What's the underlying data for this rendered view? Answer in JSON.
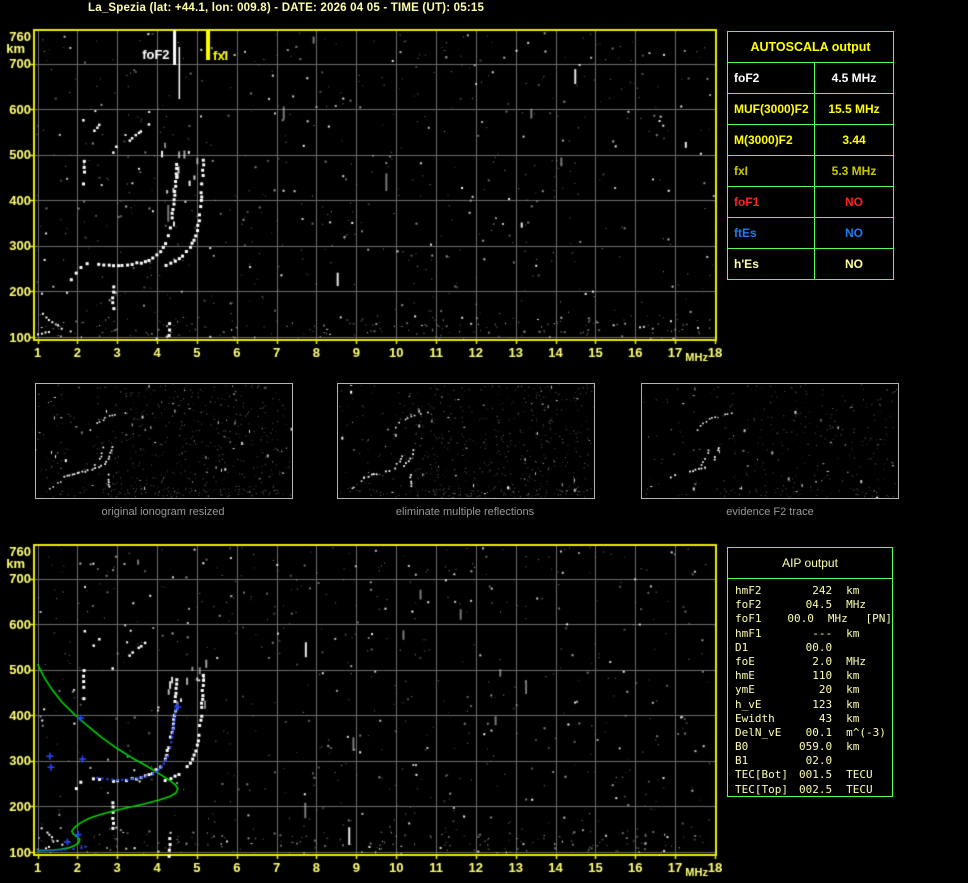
{
  "title": "La_Spezia (lat: +44.1, lon: 009.8) - DATE: 2026 04 05 - TIME (UT): 05:15",
  "colors": {
    "title_text": "#ffffa8",
    "axis_text": "#ffff78",
    "plot_border": "#ecec00",
    "grid": "#6a6a6a",
    "noise_dim": "#989898",
    "noise_bright": "#ffffff",
    "trace_white": "#ffffff",
    "table_border": "#55ff55",
    "autoscala_header": "#ffff00",
    "aip_text": "#ffffb0",
    "caption_text": "#989898",
    "profile_green": "#00d400",
    "restored_blue": "#2244ff",
    "marker_foF2": "#ffffff",
    "marker_fxI": "#ffff00"
  },
  "autoscala_table": {
    "header": "AUTOSCALA output",
    "rows": [
      {
        "label": "foF2",
        "value": "4.5 MHz",
        "color": "#ffffff"
      },
      {
        "label": "MUF(3000)F2",
        "value": "15.5 MHz",
        "color": "#ffff00"
      },
      {
        "label": "M(3000)F2",
        "value": "3.44",
        "color": "#ffff00"
      },
      {
        "label": "fxI",
        "value": "5.3 MHz",
        "color": "#c9c900"
      },
      {
        "label": "foF1",
        "value": "NO",
        "color": "#ff2020"
      },
      {
        "label": "ftEs",
        "value": "NO",
        "color": "#1a7cf0"
      },
      {
        "label": "h'Es",
        "value": "NO",
        "color": "#ffffa0"
      }
    ]
  },
  "aip_table": {
    "header": "AIP output",
    "rows": [
      {
        "label": "hmF2",
        "value": "242",
        "unit": "km",
        "extra": ""
      },
      {
        "label": "foF2",
        "value": "04.5",
        "unit": "MHz",
        "extra": ""
      },
      {
        "label": "foF1",
        "value": "00.0",
        "unit": "MHz",
        "extra": "[PN]"
      },
      {
        "label": "hmF1",
        "value": "---",
        "unit": "km",
        "extra": ""
      },
      {
        "label": "D1",
        "value": "00.0",
        "unit": "",
        "extra": ""
      },
      {
        "label": "foE",
        "value": "2.0",
        "unit": "MHz",
        "extra": ""
      },
      {
        "label": "hmE",
        "value": "110",
        "unit": "km",
        "extra": ""
      },
      {
        "label": "ymE",
        "value": "20",
        "unit": "km",
        "extra": ""
      },
      {
        "label": "h_vE",
        "value": "123",
        "unit": "km",
        "extra": ""
      },
      {
        "label": "Ewidth",
        "value": "43",
        "unit": "km",
        "extra": ""
      },
      {
        "label": "DelN_vE",
        "value": "00.1",
        "unit": "m^(-3)",
        "extra": ""
      },
      {
        "label": "B0",
        "value": "059.0",
        "unit": "km",
        "extra": ""
      },
      {
        "label": "B1",
        "value": "02.0",
        "unit": "",
        "extra": ""
      },
      {
        "label": "TEC[Bot]",
        "value": "001.5",
        "unit": "TECU",
        "extra": ""
      },
      {
        "label": "TEC[Top]",
        "value": "002.5",
        "unit": "TECU",
        "extra": ""
      }
    ]
  },
  "captions": {
    "panel1": "original ionogram resized",
    "panel2": "eliminate multiple reflections",
    "panel3": "evidence F2 trace"
  },
  "chart_data": {
    "type": "scatter",
    "x_axis": {
      "label": "MHz",
      "range": [
        1,
        18
      ],
      "ticks": [
        1,
        2,
        3,
        4,
        5,
        6,
        7,
        8,
        9,
        10,
        11,
        12,
        13,
        14,
        15,
        16,
        17,
        18
      ]
    },
    "y_axis": {
      "label": "km",
      "range": [
        100,
        760
      ],
      "ticks": [
        760,
        700,
        600,
        500,
        400,
        300,
        200,
        100
      ]
    },
    "grid": true,
    "ionogram_traces": {
      "e_region_segments": [
        [
          [
            1.02,
            106
          ],
          [
            1.3,
            110
          ]
        ],
        [
          [
            1.12,
            152
          ],
          [
            1.42,
            127
          ]
        ],
        [
          [
            1.5,
            124
          ],
          [
            1.62,
            117
          ]
        ]
      ],
      "f_trace_o": [
        [
          1.86,
          226
        ],
        [
          1.98,
          240
        ],
        [
          2.08,
          252
        ],
        [
          2.25,
          260
        ],
        [
          2.55,
          258
        ],
        [
          2.9,
          256
        ],
        [
          3.25,
          258
        ],
        [
          3.6,
          263
        ],
        [
          3.9,
          272
        ],
        [
          4.08,
          286
        ],
        [
          4.2,
          305
        ],
        [
          4.3,
          330
        ],
        [
          4.38,
          362
        ],
        [
          4.44,
          400
        ],
        [
          4.47,
          440
        ],
        [
          4.49,
          478
        ]
      ],
      "f_trace_x": [
        [
          4.22,
          258
        ],
        [
          4.45,
          265
        ],
        [
          4.65,
          277
        ],
        [
          4.83,
          296
        ],
        [
          4.97,
          322
        ],
        [
          5.06,
          356
        ],
        [
          5.11,
          398
        ],
        [
          5.14,
          444
        ],
        [
          5.16,
          487
        ]
      ],
      "second_hop_segments": [
        [
          [
            3.3,
            531
          ],
          [
            3.55,
            549
          ]
        ],
        [
          [
            3.6,
            552
          ],
          [
            3.78,
            566
          ]
        ],
        [
          [
            2.08,
            568
          ],
          [
            2.2,
            584
          ]
        ],
        [
          [
            2.42,
            553
          ],
          [
            2.56,
            566
          ]
        ],
        [
          [
            2.9,
            503
          ],
          [
            2.98,
            518
          ]
        ]
      ],
      "vertical_segments": [
        [
          [
            2.17,
            436
          ],
          [
            2.17,
            497
          ]
        ],
        [
          [
            2.9,
            152
          ],
          [
            2.9,
            220
          ]
        ],
        [
          [
            4.32,
            92
          ],
          [
            4.32,
            128
          ]
        ]
      ]
    },
    "top_plot": {
      "noise_seed": 7,
      "markers": [
        {
          "label": "foF2",
          "f_mhz": 4.44,
          "color": "#ffffff"
        },
        {
          "label": "fxI",
          "f_mhz": 5.28,
          "color": "#ffff00"
        }
      ]
    },
    "bottom_plot": {
      "noise_seed": 13,
      "electron_density_profile": [
        [
          1.0,
          512
        ],
        [
          1.15,
          486
        ],
        [
          1.35,
          458
        ],
        [
          1.6,
          430
        ],
        [
          1.9,
          404
        ],
        [
          2.25,
          377
        ],
        [
          2.6,
          352
        ],
        [
          3.0,
          327
        ],
        [
          3.4,
          305
        ],
        [
          3.75,
          288
        ],
        [
          4.05,
          272
        ],
        [
          4.3,
          258
        ],
        [
          4.45,
          248
        ],
        [
          4.52,
          240
        ],
        [
          4.48,
          230
        ],
        [
          4.32,
          222
        ],
        [
          4.05,
          214
        ],
        [
          3.7,
          206
        ],
        [
          3.3,
          198
        ],
        [
          2.95,
          191
        ],
        [
          2.6,
          183
        ],
        [
          2.3,
          174
        ],
        [
          2.08,
          164
        ],
        [
          1.93,
          154
        ],
        [
          1.86,
          146
        ],
        [
          1.9,
          139
        ],
        [
          2.0,
          133
        ],
        [
          2.06,
          127
        ],
        [
          2.03,
          120
        ],
        [
          1.93,
          114
        ],
        [
          1.78,
          109
        ],
        [
          1.58,
          106
        ],
        [
          1.35,
          104
        ],
        [
          1.0,
          103
        ]
      ],
      "restored_trace_e": [
        [
          1.0,
          104
        ],
        [
          1.3,
          104
        ],
        [
          1.6,
          105
        ],
        [
          1.9,
          107
        ],
        [
          2.1,
          109
        ],
        [
          2.2,
          112
        ]
      ],
      "restored_trace_f": [
        [
          2.5,
          263
        ],
        [
          2.75,
          260
        ],
        [
          3.0,
          258
        ],
        [
          3.25,
          259
        ],
        [
          3.5,
          262
        ],
        [
          3.72,
          266
        ],
        [
          3.9,
          272
        ],
        [
          4.05,
          281
        ],
        [
          4.17,
          294
        ],
        [
          4.26,
          310
        ],
        [
          4.33,
          330
        ],
        [
          4.38,
          352
        ],
        [
          4.42,
          378
        ],
        [
          4.45,
          402
        ],
        [
          4.47,
          420
        ]
      ],
      "restored_outliers": [
        [
          1.31,
          310
        ],
        [
          1.34,
          286
        ],
        [
          2.08,
          394
        ],
        [
          2.13,
          304
        ],
        [
          1.75,
          122
        ],
        [
          2.02,
          138
        ],
        [
          4.52,
          418
        ]
      ]
    },
    "mini_panels": {
      "trace_main": [
        [
          0.1,
          0.83
        ],
        [
          0.13,
          0.8
        ],
        [
          0.17,
          0.775
        ],
        [
          0.21,
          0.755
        ],
        [
          0.245,
          0.73
        ],
        [
          0.268,
          0.7
        ],
        [
          0.283,
          0.66
        ],
        [
          0.292,
          0.61
        ],
        [
          0.298,
          0.56
        ]
      ],
      "trace_x_branch": [
        [
          0.232,
          0.705
        ],
        [
          0.248,
          0.66
        ],
        [
          0.258,
          0.61
        ],
        [
          0.263,
          0.555
        ]
      ],
      "trace_arc": [
        [
          0.215,
          0.41
        ],
        [
          0.24,
          0.345
        ],
        [
          0.272,
          0.295
        ],
        [
          0.31,
          0.265
        ],
        [
          0.35,
          0.255
        ]
      ],
      "trace_vertical": [
        [
          0.285,
          0.8
        ],
        [
          0.285,
          0.9
        ]
      ],
      "trace_lower_left": [
        [
          0.055,
          0.92
        ],
        [
          0.075,
          0.885
        ],
        [
          0.095,
          0.855
        ]
      ],
      "panels": [
        {
          "noise_seed": 21,
          "noise_count": 560,
          "bright_count": 70,
          "full_trace": true
        },
        {
          "noise_seed": 45,
          "noise_count": 600,
          "bright_count": 55,
          "full_trace": true
        },
        {
          "noise_seed": 77,
          "noise_count": 300,
          "bright_count": 45,
          "full_trace": false
        }
      ]
    }
  }
}
